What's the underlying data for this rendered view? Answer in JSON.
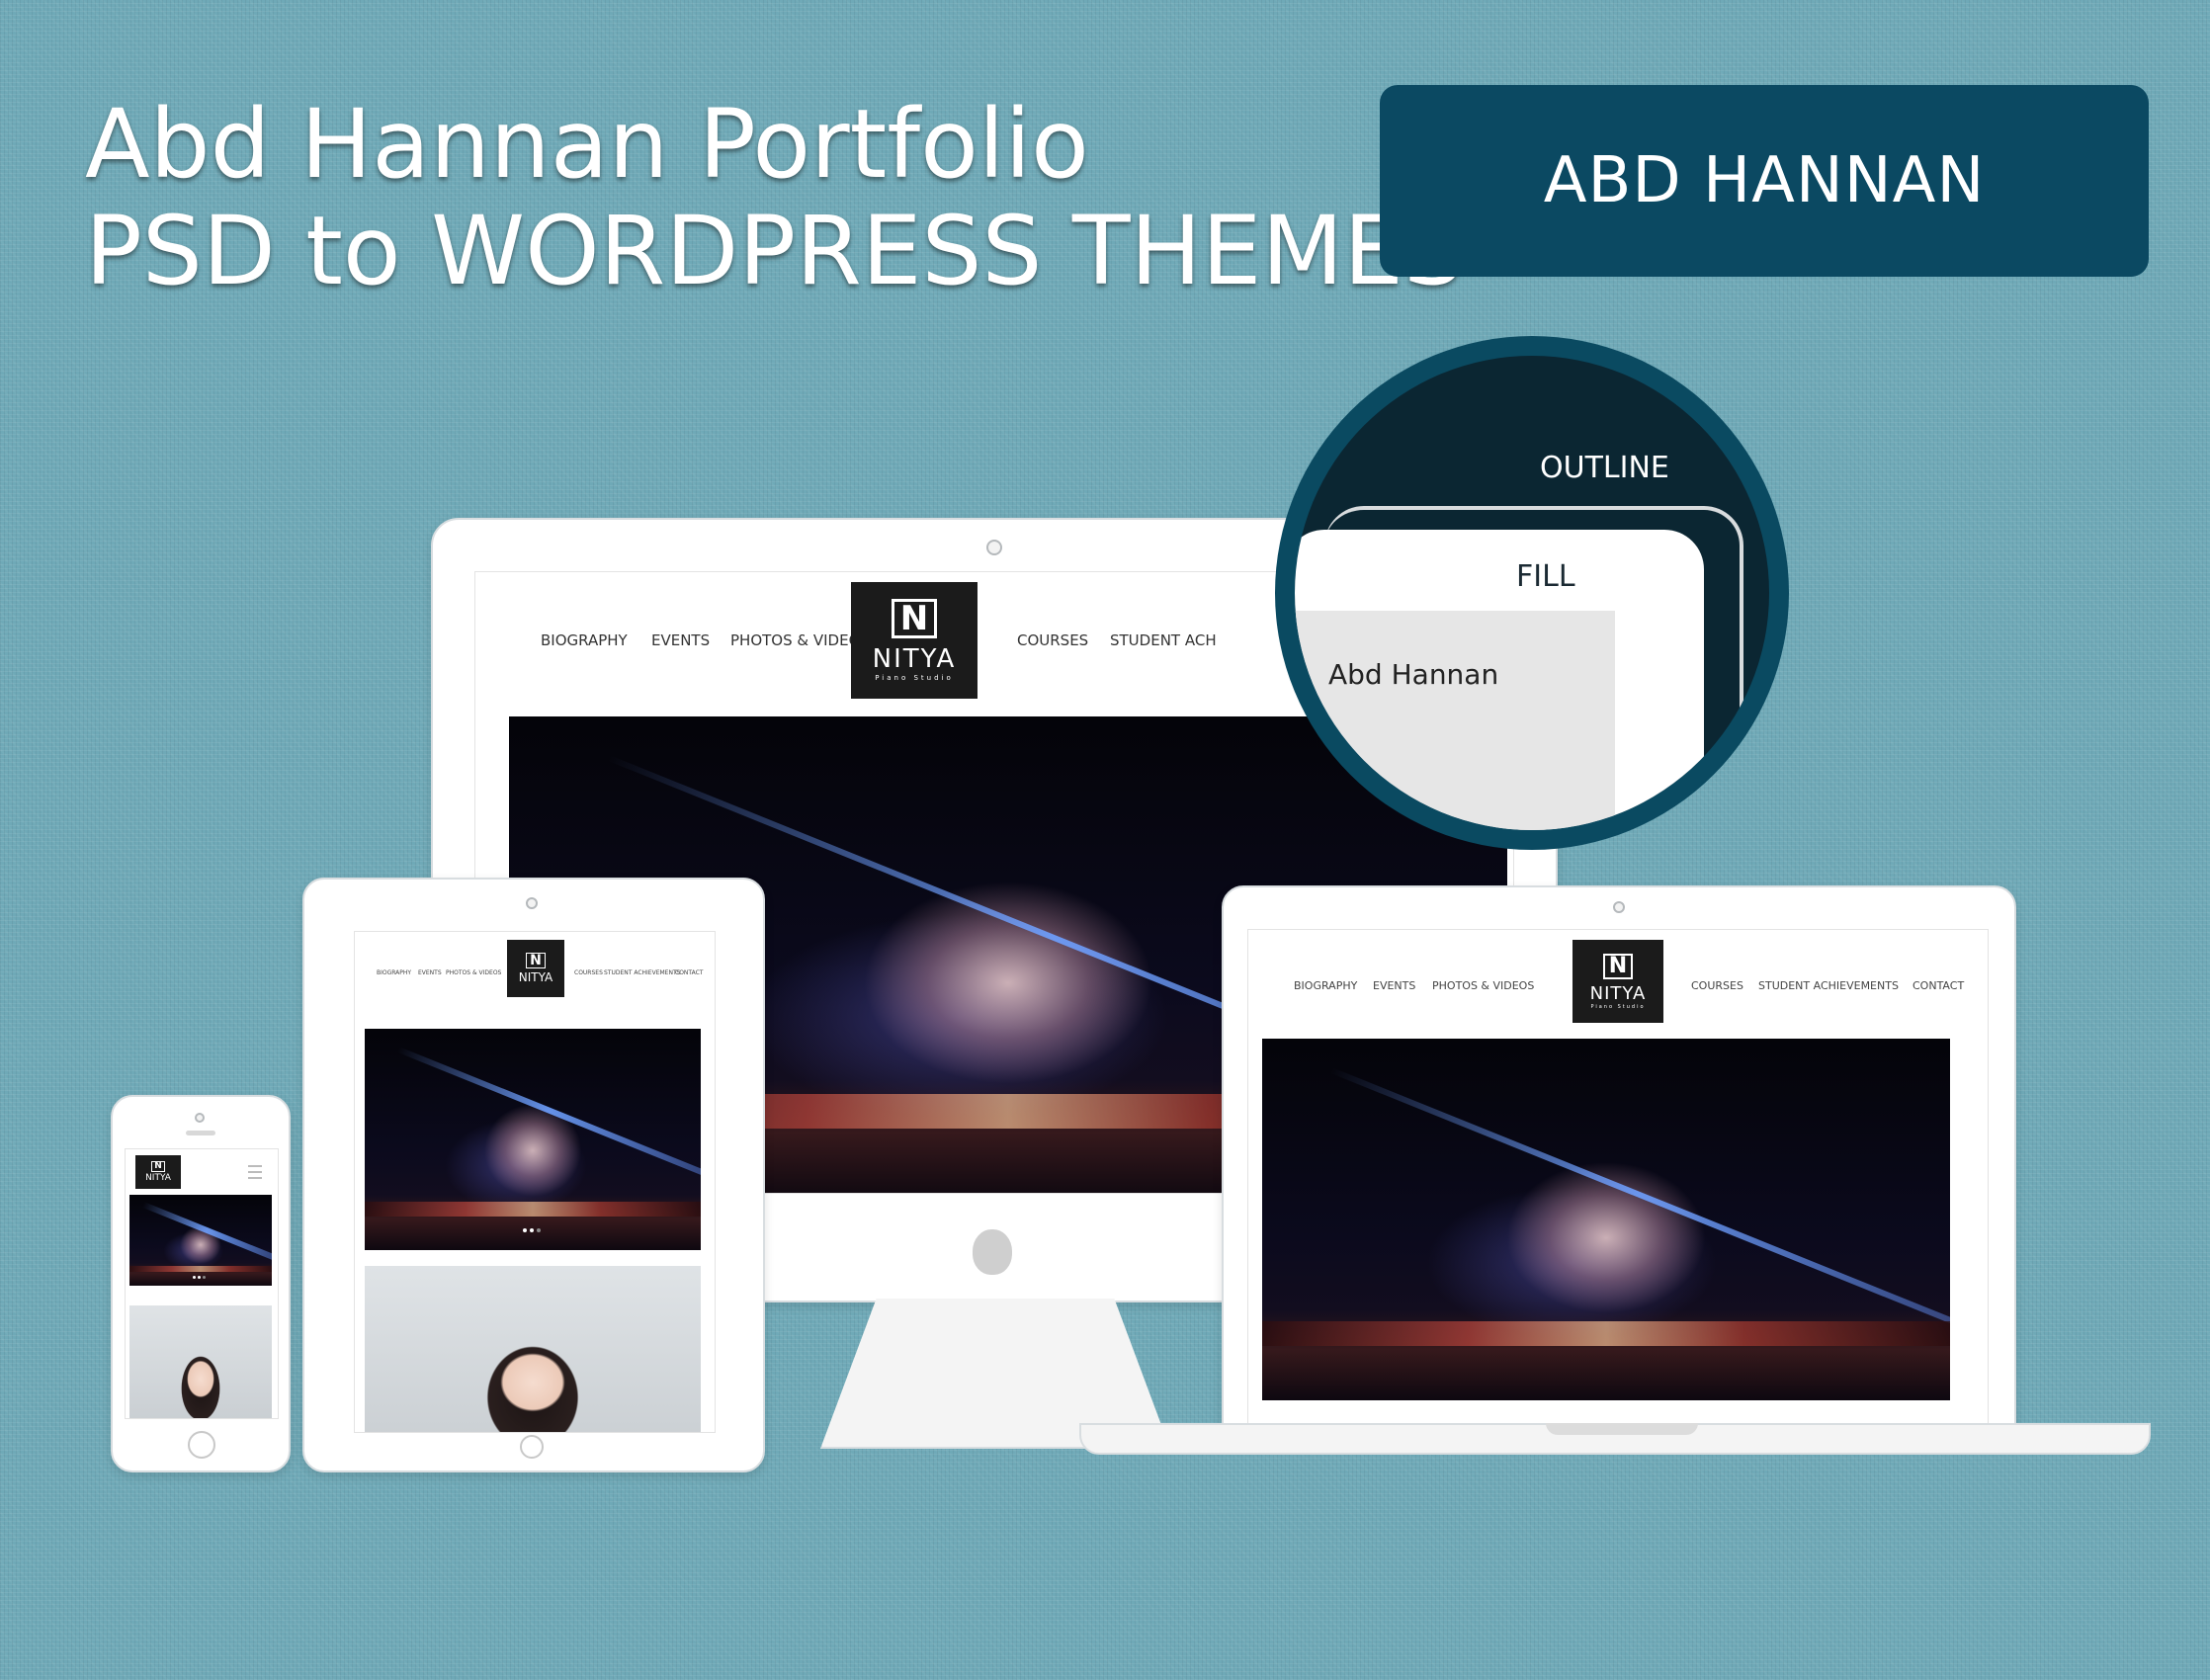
{
  "header": {
    "title_line1": "Abd Hannan Portfolio",
    "title_line2": "PSD to WORDPRESS THEMES",
    "brand_box_label": "ABD HANNAN"
  },
  "callout": {
    "outline_label": "OUTLINE",
    "fill_label": "FILL",
    "sample_text": "Abd Hannan"
  },
  "site": {
    "logo_mark": "N",
    "logo_name": "NITYA",
    "logo_tagline": "Piano Studio",
    "nav_left": [
      "BIOGRAPHY",
      "EVENTS",
      "PHOTOS & VIDEOS"
    ],
    "nav_right": [
      "COURSES",
      "STUDENT ACHIEVEMENTS",
      "CONTACT"
    ],
    "nav_right_desktop_visible": [
      "COURSES",
      "STUDENT ACH"
    ]
  },
  "colors": {
    "background": "#6fa9b7",
    "brand_box": "#0b4962",
    "callout_ring": "#0a4a61",
    "callout_inner": "#0b2632"
  },
  "icons": [
    "apple-logo-icon",
    "home-button-icon",
    "menu-icon",
    "camera-dot-icon"
  ]
}
